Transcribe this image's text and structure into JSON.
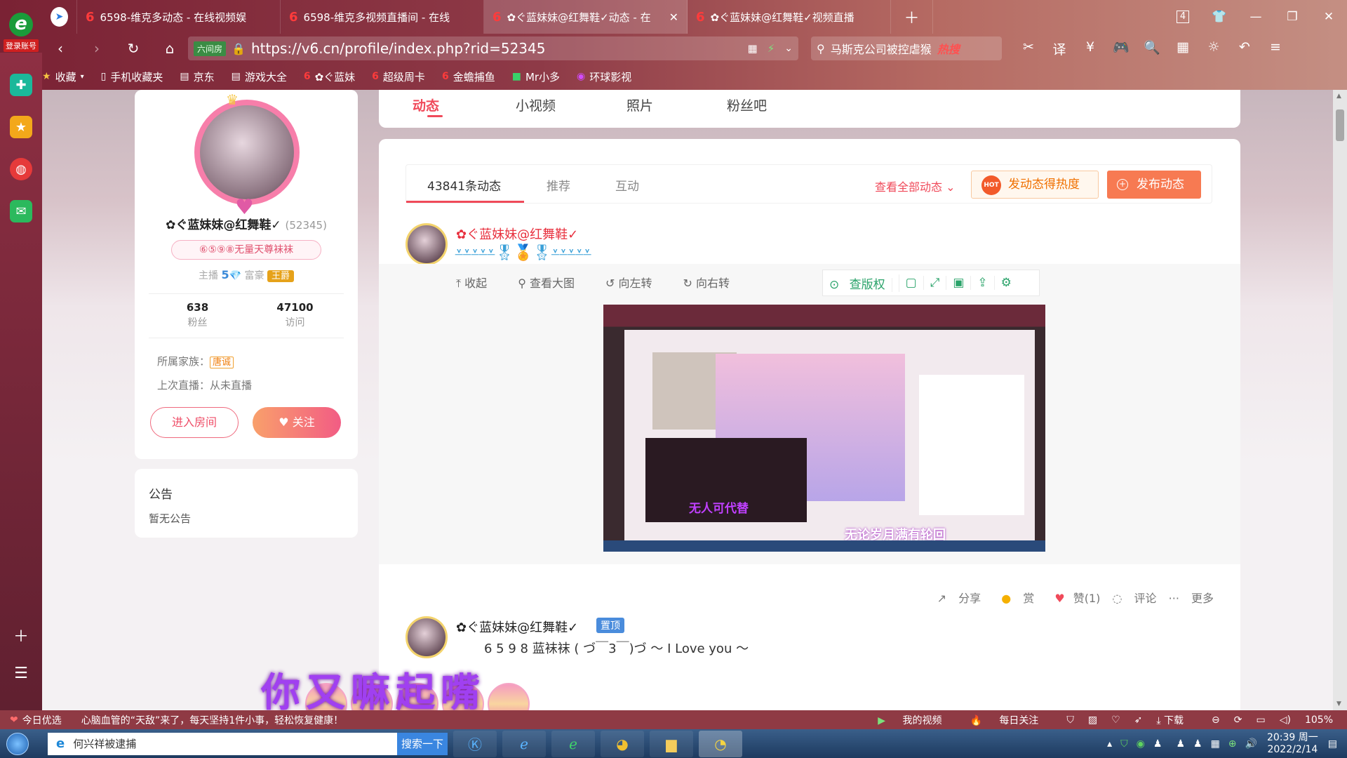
{
  "browser": {
    "login_label": "登录账号",
    "tabs": [
      {
        "title": "6598-维克多动态 - 在线视频娱"
      },
      {
        "title": "6598-维克多视频直播间 - 在线"
      },
      {
        "title": "✿ぐ蓝妹妹@红舞鞋✓动态 - 在"
      },
      {
        "title": "✿ぐ蓝妹妹@红舞鞋✓视频直播"
      }
    ],
    "tab_count": "4",
    "secure_label": "六间房",
    "url": "https://v6.cn/profile/index.php?rid=52345",
    "search_text": "马斯克公司被控虐猴",
    "search_hot": "热搜",
    "bookmarks": [
      "收藏",
      "手机收藏夹",
      "京东",
      "游戏大全",
      "✿ぐ蓝妹",
      "超级周卡",
      "金蟾捕鱼",
      "Mr小多",
      "环球影视"
    ]
  },
  "profile": {
    "name": "✿ぐ蓝妹妹@红舞鞋✓",
    "rid": "(52345)",
    "title_pill": "⑥⑤⑨⑧无量天尊袜袜",
    "anchor_label": "主播",
    "anchor_level": "5",
    "rich_label": "富豪",
    "rich_level": "王爵",
    "fans_count": "638",
    "fans_label": "粉丝",
    "visits_count": "47100",
    "visits_label": "访问",
    "clan_label": "所属家族：",
    "clan_name": "唐诚",
    "last_live": "上次直播：从未直播",
    "enter_room": "进入房间",
    "follow": "关注"
  },
  "notice": {
    "title": "公告",
    "content": "暂无公告"
  },
  "main_tabs": [
    "动态",
    "小视频",
    "照片",
    "粉丝吧"
  ],
  "feed": {
    "count_tab": "43841条动态",
    "tab_recommend": "推荐",
    "tab_interact": "互动",
    "view_all": "查看全部动态",
    "hot_button": "发动态得热度",
    "hot_badge": "HOT",
    "publish_button": "发布动态",
    "post1": {
      "name": "✿ぐ蓝妹妹@红舞鞋✓",
      "tools": [
        "收起",
        "查看大图",
        "向左转",
        "向右转"
      ],
      "copyright": "查版权",
      "shot_caption": "无论岁月满有轮回",
      "shot_caption2": "无人可代替",
      "actions": [
        "分享",
        "赏",
        "赞(1)",
        "评论",
        "更多"
      ]
    },
    "post2": {
      "name": "✿ぐ蓝妹妹@红舞鞋✓",
      "pin": "置顶",
      "line": "6 5 9 8 蓝袜袜 ( づ￣3￣)づ ～ I Love you ～"
    }
  },
  "overlay_text": "你又嘛起嘴",
  "statusbar": {
    "left1": "今日优选",
    "left2": "心脑血管的“天敌”来了，每天坚持1件小事，轻松恢复健康！",
    "right": [
      "我的视频",
      "每日关注",
      "下载"
    ],
    "zoom": "105%"
  },
  "taskbar": {
    "search_text": "何兴祥被逮捕",
    "search_button": "搜索一下",
    "time": "20:39 周一",
    "date": "2022/2/14"
  }
}
